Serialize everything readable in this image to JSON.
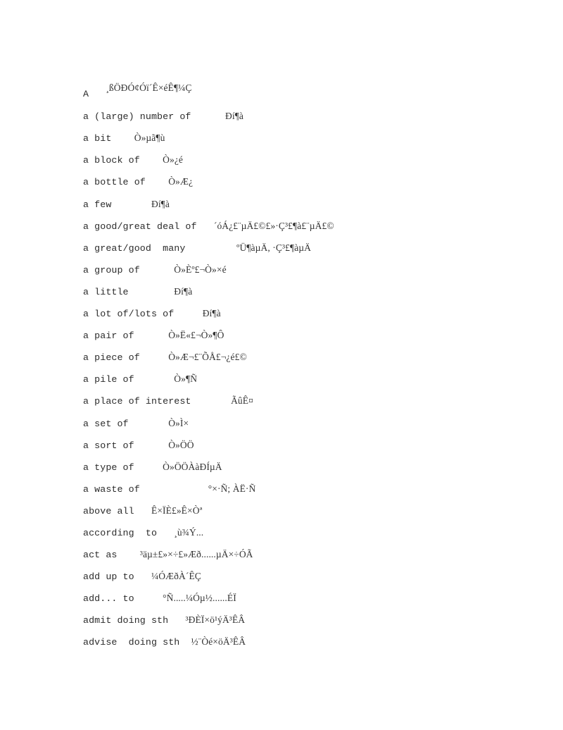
{
  "document": {
    "title": "¸ßÖÐÓ¢Óï´Ê×éÊ¶¼Ç",
    "section_letter": "A",
    "entries": [
      {
        "term": "a (large) number of",
        "gap": "      ",
        "gloss": "Ðí¶à"
      },
      {
        "term": "a bit",
        "gap": "    ",
        "gloss": "Ò»µã¶ù"
      },
      {
        "term": "a block of",
        "gap": "    ",
        "gloss": "Ò»¿é"
      },
      {
        "term": "a bottle of",
        "gap": "    ",
        "gloss": "Ò»Æ¿"
      },
      {
        "term": "a few",
        "gap": "       ",
        "gloss": "Ðí¶à"
      },
      {
        "term": "a good/great deal of",
        "gap": "   ",
        "gloss": "´óÁ¿£¨µÄ£©£»·Ç³£¶à£¨µÄ£©"
      },
      {
        "term": "a great/good  many",
        "gap": "         ",
        "gloss": "ºÜ¶àµÄ, ·Ç³£¶àµÄ"
      },
      {
        "term": "a group of",
        "gap": "      ",
        "gloss": "Ò»Èº£¬Ò»×é"
      },
      {
        "term": "a little",
        "gap": "        ",
        "gloss": "Ðí¶à"
      },
      {
        "term": "a lot of/lots of",
        "gap": "     ",
        "gloss": "Ðí¶à"
      },
      {
        "term": "a pair of",
        "gap": "      ",
        "gloss": "Ò»Ë«£¬Ò»¶Ô"
      },
      {
        "term": "a piece of",
        "gap": "     ",
        "gloss": "Ò»Æ¬£¨ÕÅ£¬¿é£©"
      },
      {
        "term": "a pile of",
        "gap": "       ",
        "gloss": "Ò»¶Ñ"
      },
      {
        "term": "a place of interest",
        "gap": "       ",
        "gloss": "ÃûÊ¤"
      },
      {
        "term": "a set of",
        "gap": "       ",
        "gloss": "Ò»Ì×"
      },
      {
        "term": "a sort of",
        "gap": "      ",
        "gloss": "Ò»ÖÖ"
      },
      {
        "term": "a type of",
        "gap": "     ",
        "gloss": "Ò»ÖÖÀàÐÍµÄ"
      },
      {
        "term": "a waste of",
        "gap": "            ",
        "gloss": "°×·Ñ; ÀË·Ñ"
      },
      {
        "term": "above all",
        "gap": "   ",
        "gloss": "Ê×ÏÈ£»Ê×Òª"
      },
      {
        "term": "according  to",
        "gap": "   ",
        "gloss": "¸ù¾Ý..."
      },
      {
        "term": "act as",
        "gap": "    ",
        "gloss": "³äµ±£»×÷£»Æð......µÄ×÷ÓÃ"
      },
      {
        "term": "add up to",
        "gap": "   ",
        "gloss": "¼ÓÆðÀ´ÊÇ"
      },
      {
        "term": "add... to",
        "gap": "     ",
        "gloss": "°Ñ.....¼Óµ½......ÉÏ"
      },
      {
        "term": "admit doing sth",
        "gap": "   ",
        "gloss": "³ÐÈÏ×ö¹ýÄ³ÊÂ"
      },
      {
        "term": "advise  doing sth",
        "gap": "  ",
        "gloss": "½¨Òé×öÄ³ÊÂ"
      }
    ]
  }
}
